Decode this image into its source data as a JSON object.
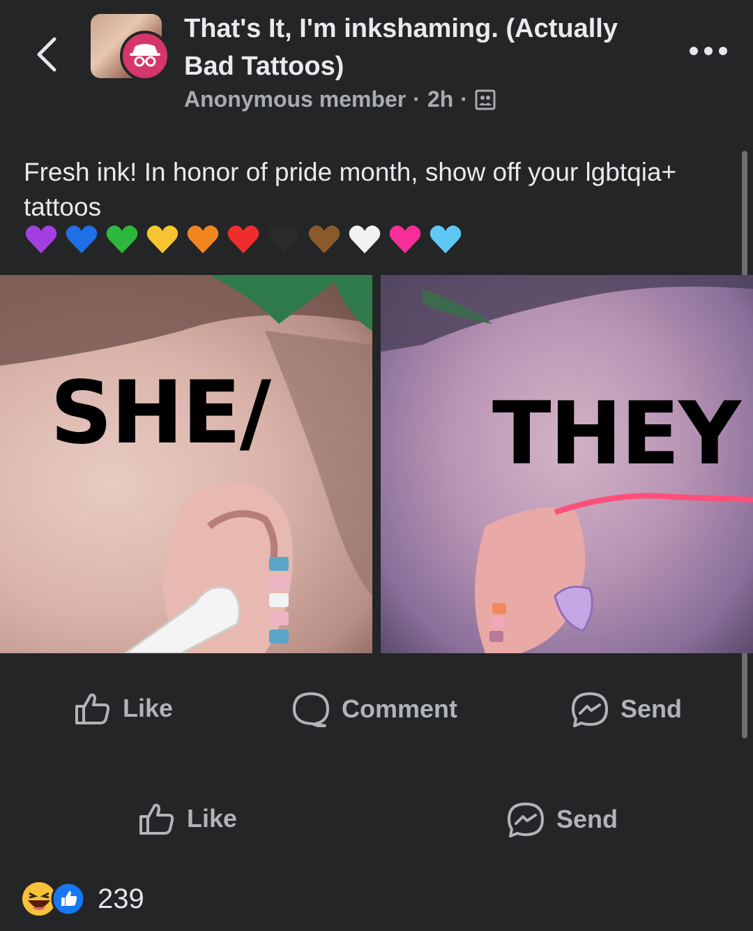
{
  "header": {
    "group_name": "That's It, I'm inkshaming. (Actually Bad Tattoos)",
    "author": "Anonymous member",
    "separator": "·",
    "time": "2h"
  },
  "post": {
    "text": "Fresh ink! In honor of pride month, show off your lgbtqia+ tattoos",
    "hearts": [
      "#a23fe0",
      "#1f6fe5",
      "#2db83d",
      "#f6c431",
      "#f2861e",
      "#ef2d2d",
      "#2a2a2a",
      "#8b5a2b",
      "#f2f2f2",
      "#f52f97",
      "#5ec8f3"
    ],
    "photos": {
      "left_word": "SHE/",
      "right_word": "THEY"
    }
  },
  "actions": {
    "like": "Like",
    "comment": "Comment",
    "send": "Send"
  },
  "footer": {
    "reaction_count": "239"
  },
  "colors": {
    "background": "#242526",
    "text_primary": "#e4e6eb",
    "text_secondary": "#b0b3b8",
    "badge": "#d6366a",
    "like_blue": "#1877f2"
  }
}
